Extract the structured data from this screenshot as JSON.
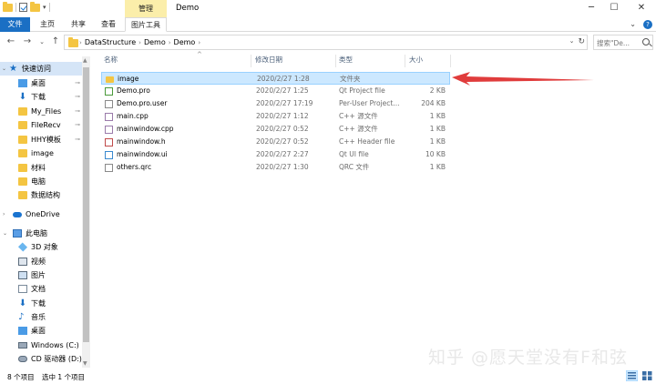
{
  "window": {
    "title": "Demo",
    "context_tab": "管理"
  },
  "ribbon": {
    "tabs": [
      {
        "label": "文件"
      },
      {
        "label": "主页"
      },
      {
        "label": "共享"
      },
      {
        "label": "查看"
      },
      {
        "label": "图片工具"
      }
    ]
  },
  "address": {
    "crumbs": [
      "DataStructure",
      "Demo",
      "Demo"
    ],
    "search_placeholder": "搜索\"De..."
  },
  "nav": {
    "items": [
      {
        "label": "快速访问",
        "icon": "star-icon"
      },
      {
        "label": "桌面",
        "icon": "desktop-icon",
        "pinned": true
      },
      {
        "label": "下载",
        "icon": "download-icon",
        "pinned": true
      },
      {
        "label": "My_Files",
        "icon": "folder-icon",
        "pinned": true
      },
      {
        "label": "FileRecv",
        "icon": "folder-icon",
        "pinned": true
      },
      {
        "label": "HHY模板",
        "icon": "folder-icon",
        "pinned": true
      },
      {
        "label": "image",
        "icon": "folder-icon"
      },
      {
        "label": "材料",
        "icon": "folder-icon"
      },
      {
        "label": "电脑",
        "icon": "folder-icon"
      },
      {
        "label": "数据结构",
        "icon": "folder-icon"
      },
      {
        "label": "OneDrive",
        "icon": "cloud-icon"
      },
      {
        "label": "此电脑",
        "icon": "computer-icon"
      },
      {
        "label": "3D 对象",
        "icon": "cube-icon"
      },
      {
        "label": "视频",
        "icon": "video-icon"
      },
      {
        "label": "图片",
        "icon": "picture-icon"
      },
      {
        "label": "文档",
        "icon": "document-icon"
      },
      {
        "label": "下载",
        "icon": "download-icon"
      },
      {
        "label": "音乐",
        "icon": "music-icon"
      },
      {
        "label": "桌面",
        "icon": "desktop-icon"
      },
      {
        "label": "Windows (C:)",
        "icon": "drive-icon"
      },
      {
        "label": "CD 驱动器 (D:)",
        "icon": "cd-drive-icon"
      }
    ]
  },
  "columns": {
    "name": "名称",
    "date": "修改日期",
    "type": "类型",
    "size": "大小"
  },
  "files": [
    {
      "name": "image",
      "date": "2020/2/27 1:28",
      "type": "文件夹",
      "size": "",
      "icon": "folder-icon",
      "selected": true
    },
    {
      "name": "Demo.pro",
      "date": "2020/2/27 1:25",
      "type": "Qt Project file",
      "size": "2 KB",
      "icon": "qt-project-icon"
    },
    {
      "name": "Demo.pro.user",
      "date": "2020/2/27 17:19",
      "type": "Per-User Project...",
      "size": "204 KB",
      "icon": "user-file-icon"
    },
    {
      "name": "main.cpp",
      "date": "2020/2/27 1:12",
      "type": "C++ 源文件",
      "size": "1 KB",
      "icon": "cpp-file-icon"
    },
    {
      "name": "mainwindow.cpp",
      "date": "2020/2/27 0:52",
      "type": "C++ 源文件",
      "size": "1 KB",
      "icon": "cpp-file-icon"
    },
    {
      "name": "mainwindow.h",
      "date": "2020/2/27 0:52",
      "type": "C++ Header file",
      "size": "1 KB",
      "icon": "header-file-icon"
    },
    {
      "name": "mainwindow.ui",
      "date": "2020/2/27 2:27",
      "type": "Qt UI file",
      "size": "10 KB",
      "icon": "ui-file-icon"
    },
    {
      "name": "others.qrc",
      "date": "2020/2/27 1:30",
      "type": "QRC 文件",
      "size": "1 KB",
      "icon": "qrc-file-icon"
    }
  ],
  "status": {
    "count": "8 个项目",
    "selection": "选中 1 个项目"
  },
  "watermark": "知乎 @愿天堂没有F和弦",
  "colors": {
    "accent": "#1a6fc4",
    "selection": "#cce8ff",
    "annotation": "#e03c3c",
    "context_tab": "#fbeeaa"
  }
}
